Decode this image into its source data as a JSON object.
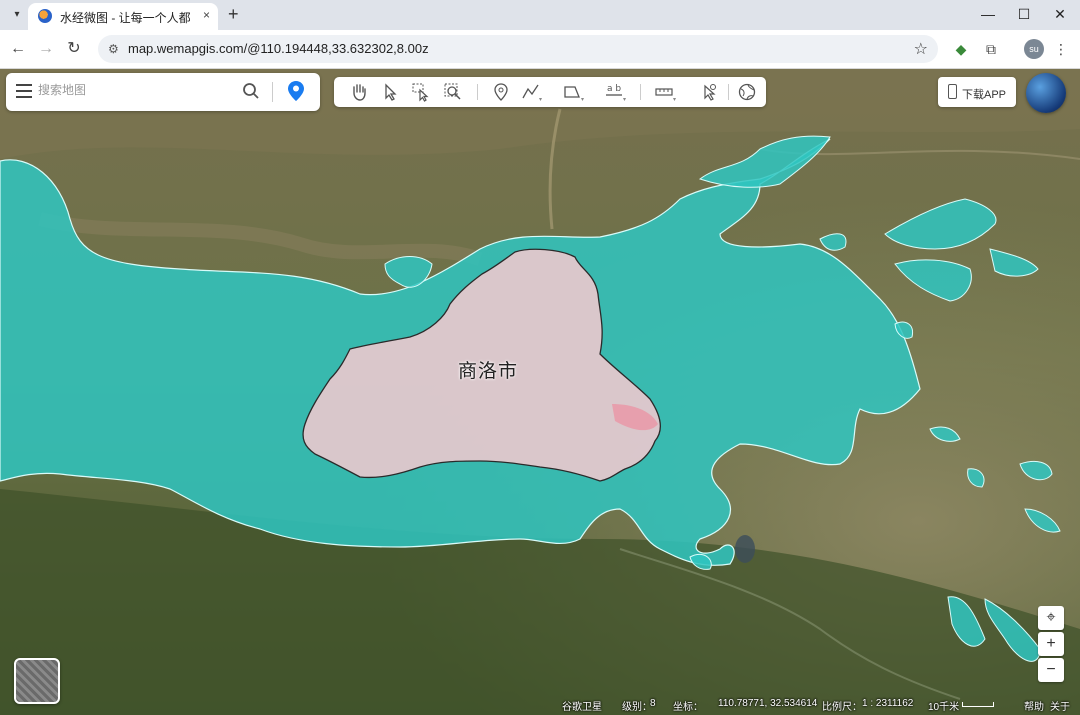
{
  "browser": {
    "tab_title": "水经微图 - 让每一个人都有自己",
    "tab_close": "×",
    "new_tab": "+",
    "url": "map.wemapgis.com/@110.194448,33.632302,8.00z",
    "profile_initials": "su",
    "window_controls": [
      "—",
      "☐",
      "✕"
    ]
  },
  "search": {
    "placeholder": "搜索地图"
  },
  "tools": [
    "pan-hand",
    "select-arrow",
    "box-select",
    "zoom-area",
    "place-marker",
    "draw-line",
    "draw-polygon",
    "text-label",
    "measure-ruler",
    "pointer-edit",
    "globe-settings"
  ],
  "download_label": "下载APP",
  "map": {
    "city_label": "商洛市",
    "colors": {
      "highlight": "#f0c8cf",
      "overlay": "#2fc5c1"
    }
  },
  "zoom": {
    "locate": "⌖",
    "in": "+",
    "out": "−"
  },
  "status": {
    "basemap": "谷歌卫星",
    "level_label": "级别：",
    "level": "8",
    "coord_label": "坐标：",
    "coords": "110.78771, 32.534614",
    "scale_label": "比例尺：",
    "scale": "1 : 2311162",
    "scale_bar": "10千米",
    "help": "帮助",
    "about": "关于"
  }
}
